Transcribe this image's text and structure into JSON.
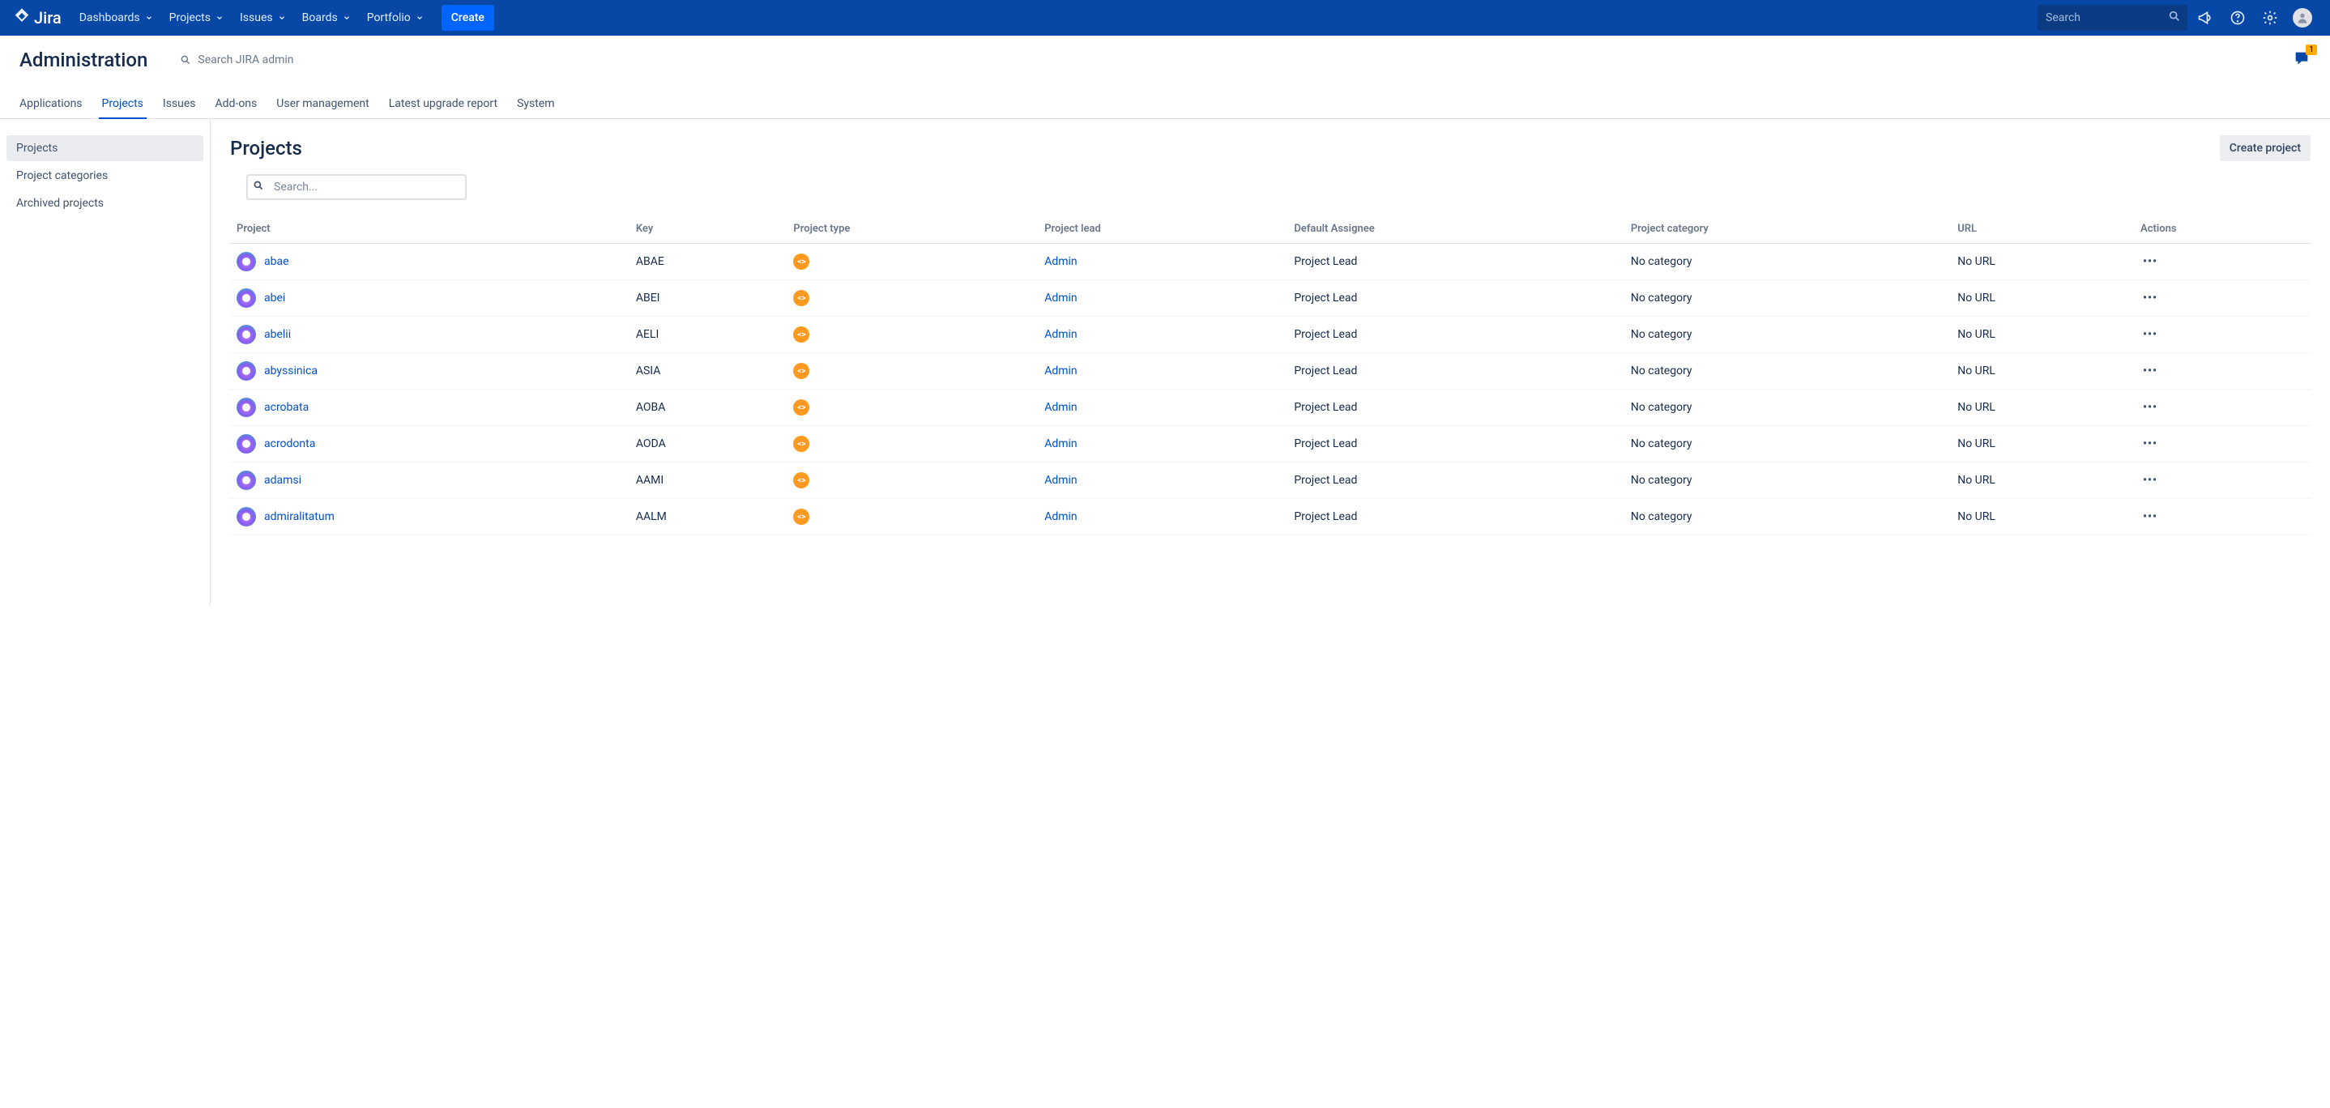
{
  "topnav": {
    "logo_text": "Jira",
    "items": [
      {
        "label": "Dashboards"
      },
      {
        "label": "Projects"
      },
      {
        "label": "Issues"
      },
      {
        "label": "Boards"
      },
      {
        "label": "Portfolio"
      }
    ],
    "create_label": "Create",
    "search_placeholder": "Search"
  },
  "admin_header": {
    "title": "Administration",
    "search_label": "Search JIRA admin",
    "feedback_badge": "1"
  },
  "admin_tabs": [
    {
      "label": "Applications",
      "active": false
    },
    {
      "label": "Projects",
      "active": true
    },
    {
      "label": "Issues",
      "active": false
    },
    {
      "label": "Add-ons",
      "active": false
    },
    {
      "label": "User management",
      "active": false
    },
    {
      "label": "Latest upgrade report",
      "active": false
    },
    {
      "label": "System",
      "active": false
    }
  ],
  "sidebar": [
    {
      "label": "Projects",
      "active": true
    },
    {
      "label": "Project categories",
      "active": false
    },
    {
      "label": "Archived projects",
      "active": false
    }
  ],
  "main": {
    "page_title": "Projects",
    "create_project_label": "Create project",
    "filter_placeholder": "Search..."
  },
  "table": {
    "columns": [
      "Project",
      "Key",
      "Project type",
      "Project lead",
      "Default Assignee",
      "Project category",
      "URL",
      "Actions"
    ],
    "rows": [
      {
        "name": "abae",
        "key": "ABAE",
        "lead": "Admin",
        "assignee": "Project Lead",
        "category": "No category",
        "url": "No URL"
      },
      {
        "name": "abei",
        "key": "ABEI",
        "lead": "Admin",
        "assignee": "Project Lead",
        "category": "No category",
        "url": "No URL"
      },
      {
        "name": "abelii",
        "key": "AELI",
        "lead": "Admin",
        "assignee": "Project Lead",
        "category": "No category",
        "url": "No URL"
      },
      {
        "name": "abyssinica",
        "key": "ASIA",
        "lead": "Admin",
        "assignee": "Project Lead",
        "category": "No category",
        "url": "No URL"
      },
      {
        "name": "acrobata",
        "key": "AOBA",
        "lead": "Admin",
        "assignee": "Project Lead",
        "category": "No category",
        "url": "No URL"
      },
      {
        "name": "acrodonta",
        "key": "AODA",
        "lead": "Admin",
        "assignee": "Project Lead",
        "category": "No category",
        "url": "No URL"
      },
      {
        "name": "adamsi",
        "key": "AAMI",
        "lead": "Admin",
        "assignee": "Project Lead",
        "category": "No category",
        "url": "No URL"
      },
      {
        "name": "admiralitatum",
        "key": "AALM",
        "lead": "Admin",
        "assignee": "Project Lead",
        "category": "No category",
        "url": "No URL"
      }
    ]
  }
}
